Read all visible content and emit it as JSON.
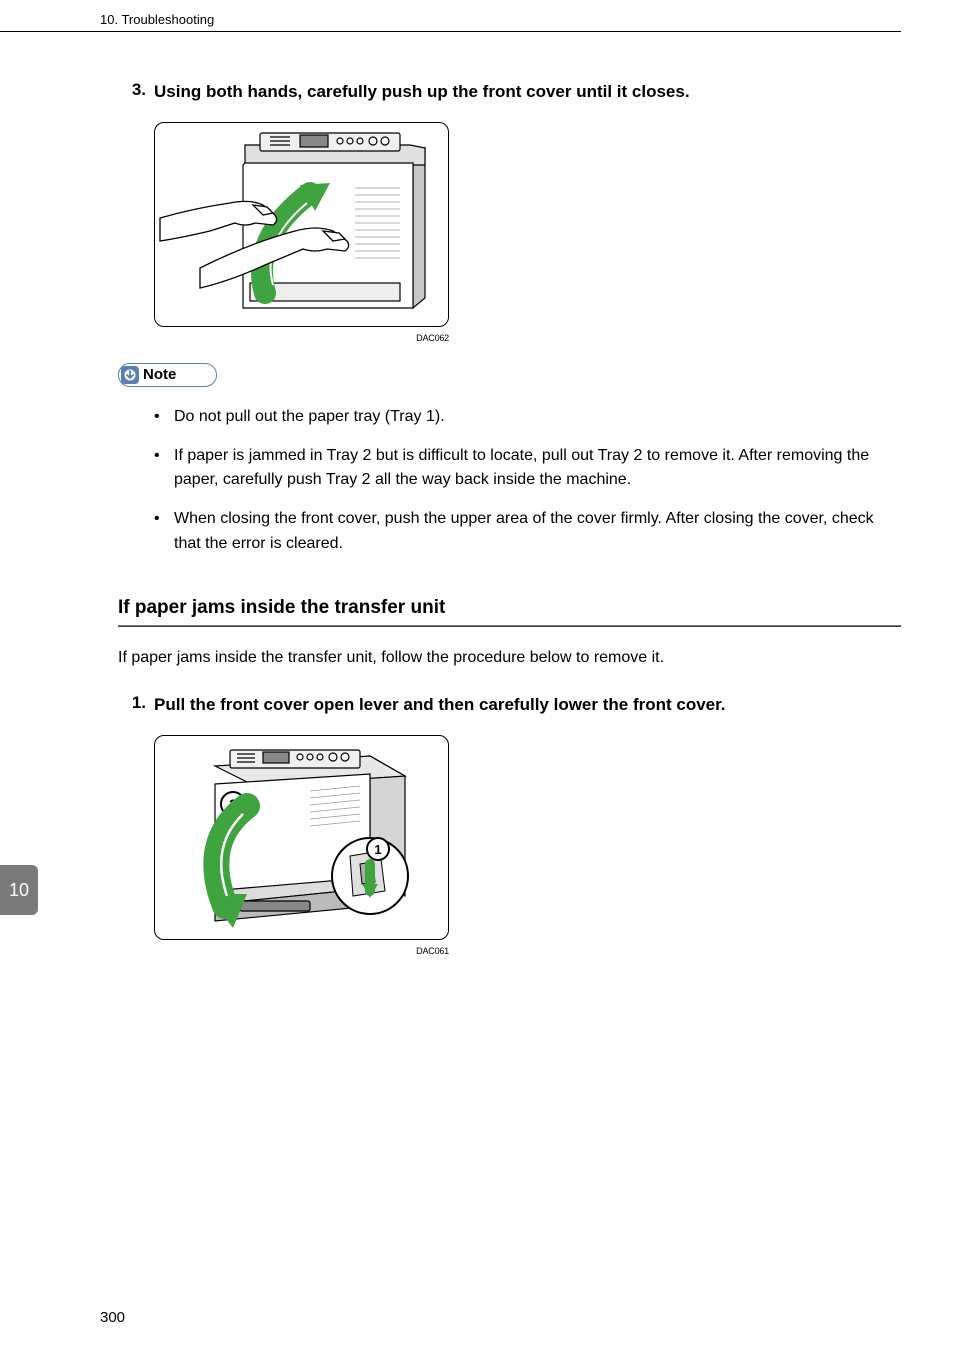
{
  "header": {
    "chapter": "10. Troubleshooting"
  },
  "step3": {
    "number": "3.",
    "text": "Using both hands, carefully push up the front cover until it closes.",
    "imageCode": "DAC062"
  },
  "note": {
    "label": "Note",
    "items": [
      "Do not pull out the paper tray (Tray 1).",
      "If paper is jammed in Tray 2 but is difficult to locate, pull out Tray 2 to remove it. After removing the paper, carefully push Tray 2 all the way back inside the machine.",
      "When closing the front cover, push the upper area of the cover firmly. After closing the cover, check that the error is cleared."
    ]
  },
  "section": {
    "heading": "If paper jams inside the transfer unit",
    "intro": "If paper jams inside the transfer unit, follow the procedure below to remove it."
  },
  "step1": {
    "number": "1.",
    "text": "Pull the front cover open lever and then carefully lower the front cover.",
    "imageCode": "DAC061",
    "callout1": "1",
    "callout2": "2"
  },
  "sideTab": "10",
  "pageNumber": "300"
}
